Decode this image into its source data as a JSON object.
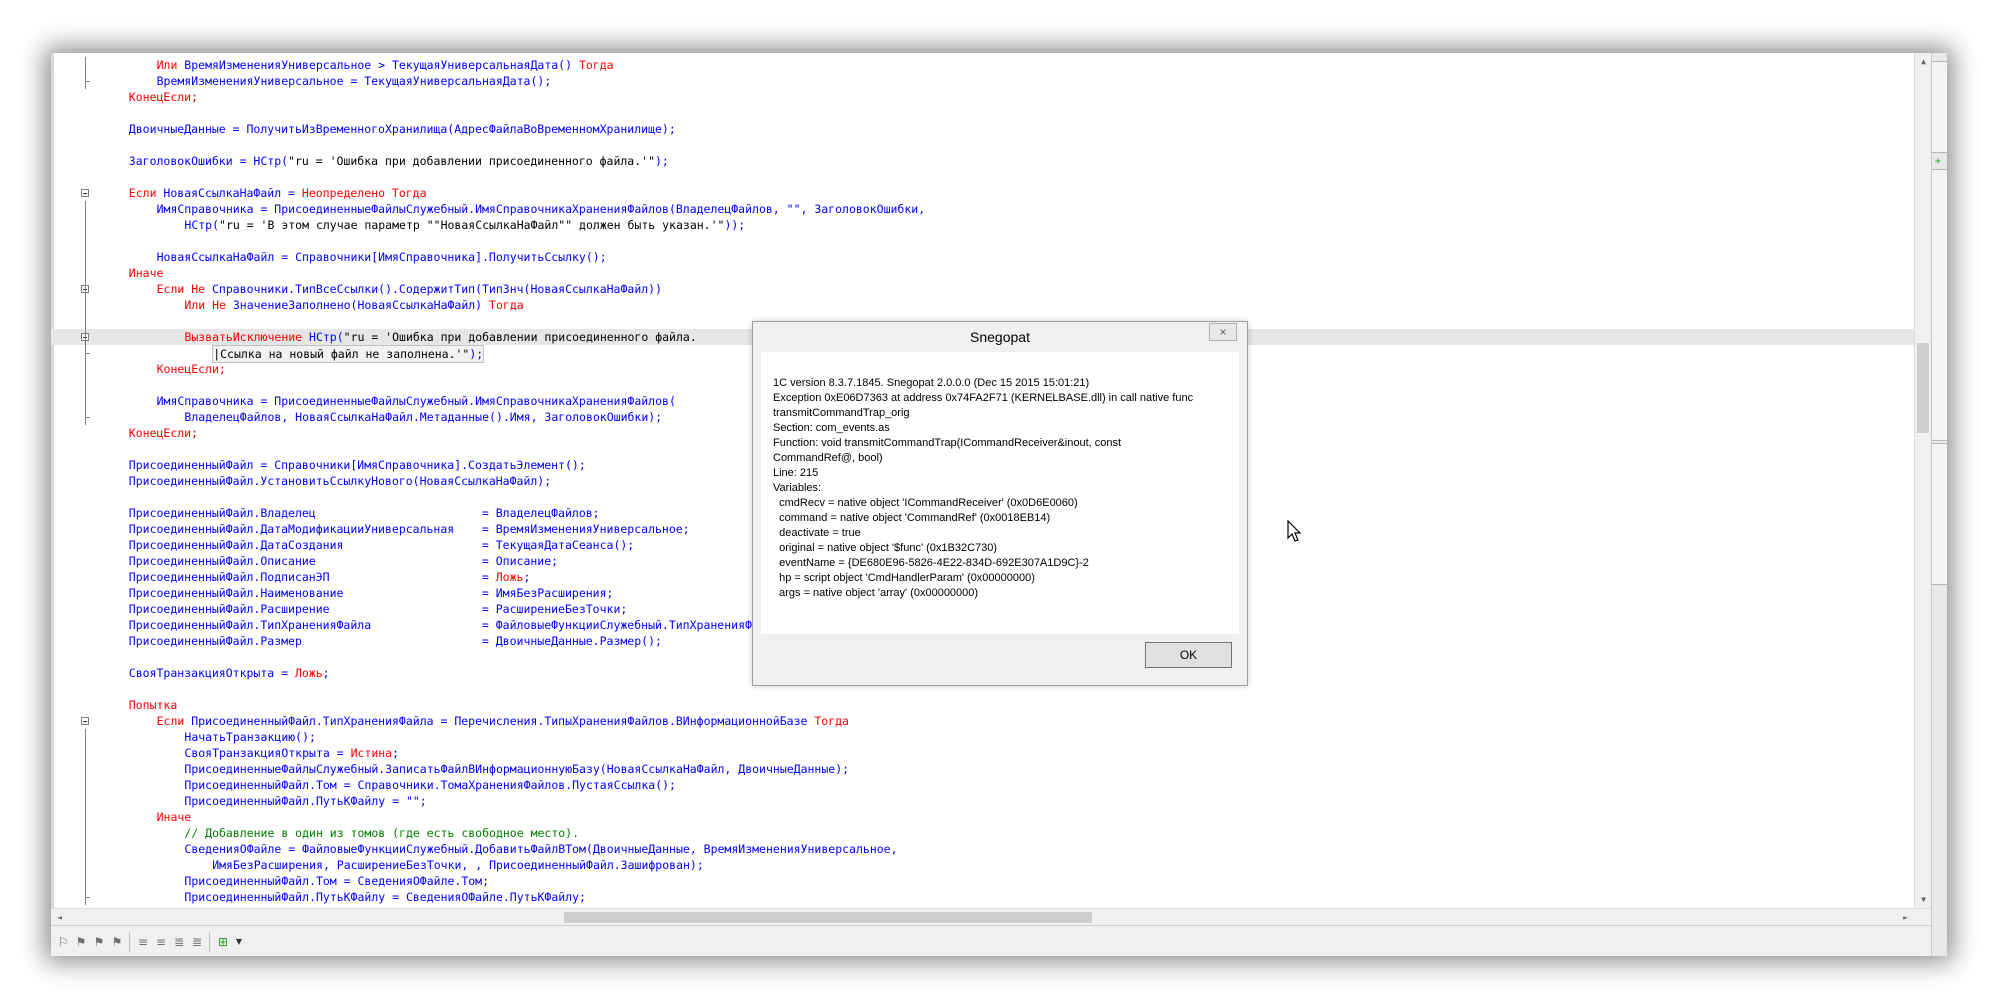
{
  "code_lines": [
    {
      "indent": "        ",
      "segments": [
        [
          "k",
          "Или "
        ],
        [
          "i",
          "ВремяИзмененияУниверсальное > ТекущаяУниверсальнаяДата() "
        ],
        [
          "k",
          "Тогда"
        ]
      ]
    },
    {
      "indent": "        ",
      "segments": [
        [
          "i",
          "ВремяИзмененияУниверсальное = ТекущаяУниверсальнаяДата();"
        ]
      ]
    },
    {
      "indent": "    ",
      "segments": [
        [
          "k",
          "КонецЕсли;"
        ]
      ]
    },
    {
      "indent": "",
      "segments": []
    },
    {
      "indent": "    ",
      "segments": [
        [
          "i",
          "ДвоичныеДанные = ПолучитьИзВременногоХранилища(АдресФайлаВоВременномХранилище);"
        ]
      ]
    },
    {
      "indent": "",
      "segments": []
    },
    {
      "indent": "    ",
      "segments": [
        [
          "i",
          "ЗаголовокОшибки = НСтр("
        ],
        [
          "s",
          "\"ru = 'Ошибка при добавлении присоединенного файла.'\""
        ],
        [
          "i",
          ");"
        ]
      ]
    },
    {
      "indent": "",
      "segments": []
    },
    {
      "indent": "    ",
      "segments": [
        [
          "k",
          "Если "
        ],
        [
          "i",
          "НоваяСсылкаНаФайл = "
        ],
        [
          "k",
          "Неопределено Тогда"
        ]
      ]
    },
    {
      "indent": "        ",
      "segments": [
        [
          "i",
          "ИмяСправочника = ПрисоединенныеФайлыСлужебный.ИмяСправочникаХраненияФайлов(ВладелецФайлов, \"\", ЗаголовокОшибки,"
        ]
      ]
    },
    {
      "indent": "            ",
      "segments": [
        [
          "i",
          "НСтр("
        ],
        [
          "s",
          "\"ru = 'В этом случае параметр \"\"НоваяСсылкаНаФайл\"\" должен быть указан.'\""
        ],
        [
          "i",
          "));"
        ]
      ]
    },
    {
      "indent": "",
      "segments": []
    },
    {
      "indent": "        ",
      "segments": [
        [
          "i",
          "НоваяСсылкаНаФайл = Справочники[ИмяСправочника].ПолучитьСсылку();"
        ]
      ]
    },
    {
      "indent": "    ",
      "segments": [
        [
          "k",
          "Иначе"
        ]
      ]
    },
    {
      "indent": "        ",
      "segments": [
        [
          "k",
          "Если Не "
        ],
        [
          "i",
          "Справочники.ТипВсеСсылки().СодержитТип(ТипЗнч(НоваяСсылкаНаФайл))"
        ]
      ]
    },
    {
      "indent": "            ",
      "segments": [
        [
          "k",
          "Или Не "
        ],
        [
          "i",
          "ЗначениеЗаполнено(НоваяСсылкаНаФайл) "
        ],
        [
          "k",
          "Тогда"
        ]
      ]
    },
    {
      "indent": "",
      "segments": []
    },
    {
      "indent": "            ",
      "segments": [
        [
          "k",
          "ВызватьИсключение "
        ],
        [
          "i",
          "НСтр("
        ],
        [
          "s",
          "\"ru = 'Ошибка при добавлении присоединенного файла."
        ]
      ]
    },
    {
      "indent": "                ",
      "segments": [
        [
          "s",
          "|Ссылка на новый файл не заполнена.'\""
        ],
        [
          "i",
          ");"
        ]
      ]
    },
    {
      "indent": "        ",
      "segments": [
        [
          "k",
          "КонецЕсли;"
        ]
      ]
    },
    {
      "indent": "",
      "segments": []
    },
    {
      "indent": "        ",
      "segments": [
        [
          "i",
          "ИмяСправочника = ПрисоединенныеФайлыСлужебный.ИмяСправочникаХраненияФайлов("
        ]
      ]
    },
    {
      "indent": "            ",
      "segments": [
        [
          "i",
          "ВладелецФайлов, НоваяСсылкаНаФайл.Метаданные().Имя, ЗаголовокОшибки);"
        ]
      ]
    },
    {
      "indent": "    ",
      "segments": [
        [
          "k",
          "КонецЕсли;"
        ]
      ]
    },
    {
      "indent": "",
      "segments": []
    },
    {
      "indent": "    ",
      "segments": [
        [
          "i",
          "ПрисоединенныйФайл = Справочники[ИмяСправочника].СоздатьЭлемент();"
        ]
      ]
    },
    {
      "indent": "    ",
      "segments": [
        [
          "i",
          "ПрисоединенныйФайл.УстановитьСсылкуНового(НоваяСсылкаНаФайл);"
        ]
      ]
    },
    {
      "indent": "",
      "segments": []
    },
    {
      "indent": "    ",
      "segments": [
        [
          "i",
          "ПрисоединенныйФайл.Владелец                        = ВладелецФайлов;"
        ]
      ]
    },
    {
      "indent": "    ",
      "segments": [
        [
          "i",
          "ПрисоединенныйФайл.ДатаМодификацииУниверсальная    = ВремяИзмененияУниверсальное;"
        ]
      ]
    },
    {
      "indent": "    ",
      "segments": [
        [
          "i",
          "ПрисоединенныйФайл.ДатаСоздания                    = ТекущаяДатаСеанса();"
        ]
      ]
    },
    {
      "indent": "    ",
      "segments": [
        [
          "i",
          "ПрисоединенныйФайл.Описание                        = Описание;"
        ]
      ]
    },
    {
      "indent": "    ",
      "segments": [
        [
          "i",
          "ПрисоединенныйФайл.ПодписанЭП                      = "
        ],
        [
          "k",
          "Ложь"
        ],
        [
          "i",
          ";"
        ]
      ]
    },
    {
      "indent": "    ",
      "segments": [
        [
          "i",
          "ПрисоединенныйФайл.Наименование                    = ИмяБезРасширения;"
        ]
      ]
    },
    {
      "indent": "    ",
      "segments": [
        [
          "i",
          "ПрисоединенныйФайл.Расширение                      = РасширениеБезТочки;"
        ]
      ]
    },
    {
      "indent": "    ",
      "segments": [
        [
          "i",
          "ПрисоединенныйФайл.ТипХраненияФайла                = ФайловыеФункцииСлужебный.ТипХраненияФайлов();"
        ]
      ]
    },
    {
      "indent": "    ",
      "segments": [
        [
          "i",
          "ПрисоединенныйФайл.Размер                          = ДвоичныеДанные.Размер();"
        ]
      ]
    },
    {
      "indent": "",
      "segments": []
    },
    {
      "indent": "    ",
      "segments": [
        [
          "i",
          "СвояТранзакцияОткрыта = "
        ],
        [
          "k",
          "Ложь"
        ],
        [
          "i",
          ";"
        ]
      ]
    },
    {
      "indent": "",
      "segments": []
    },
    {
      "indent": "    ",
      "segments": [
        [
          "k",
          "Попытка"
        ]
      ]
    },
    {
      "indent": "        ",
      "segments": [
        [
          "k",
          "Если "
        ],
        [
          "i",
          "ПрисоединенныйФайл.ТипХраненияФайла = Перечисления.ТипыХраненияФайлов.ВИнформационнойБазе "
        ],
        [
          "k",
          "Тогда"
        ]
      ]
    },
    {
      "indent": "            ",
      "segments": [
        [
          "i",
          "НачатьТранзакцию();"
        ]
      ]
    },
    {
      "indent": "            ",
      "segments": [
        [
          "i",
          "СвояТранзакцияОткрыта = "
        ],
        [
          "k",
          "Истина"
        ],
        [
          "i",
          ";"
        ]
      ]
    },
    {
      "indent": "            ",
      "segments": [
        [
          "i",
          "ПрисоединенныеФайлыСлужебный.ЗаписатьФайлВИнформационнуюБазу(НоваяСсылкаНаФайл, ДвоичныеДанные);"
        ]
      ]
    },
    {
      "indent": "            ",
      "segments": [
        [
          "i",
          "ПрисоединенныйФайл.Том = Справочники.ТомаХраненияФайлов.ПустаяСсылка();"
        ]
      ]
    },
    {
      "indent": "            ",
      "segments": [
        [
          "i",
          "ПрисоединенныйФайл.ПутьКФайлу = \"\";"
        ]
      ]
    },
    {
      "indent": "        ",
      "segments": [
        [
          "k",
          "Иначе"
        ]
      ]
    },
    {
      "indent": "            ",
      "segments": [
        [
          "c",
          "// Добавление в один из томов (где есть свободное место)."
        ]
      ]
    },
    {
      "indent": "            ",
      "segments": [
        [
          "i",
          "СведенияОФайле = ФайловыеФункцииСлужебный.ДобавитьФайлВТом(ДвоичныеДанные, ВремяИзмененияУниверсальное,"
        ]
      ]
    },
    {
      "indent": "                ",
      "segments": [
        [
          "i",
          "ИмяБезРасширения, РасширениеБезТочки, , ПрисоединенныйФайл.Зашифрован);"
        ]
      ]
    },
    {
      "indent": "            ",
      "segments": [
        [
          "i",
          "ПрисоединенныйФайл.Том = СведенияОФайле.Том;"
        ]
      ]
    },
    {
      "indent": "            ",
      "segments": [
        [
          "i",
          "ПрисоединенныйФайл.ПутьКФайлу = СведенияОФайле.ПутьКФайлу;"
        ]
      ]
    }
  ],
  "colors": {
    "keyword": "#ff0000",
    "identifier": "#0000ff",
    "string": "#000000",
    "comment": "#008000",
    "fold_box": "#808080",
    "dialog_bg": "#f0f0f0"
  },
  "dialog": {
    "title": "Snegopat",
    "close_label": "×",
    "ok_label": "OK",
    "message_lines": [
      "1C version 8.3.7.1845. Snegopat 2.0.0.0 (Dec 15 2015 15:01:21)",
      "Exception 0xE06D7363 at address 0x74FA2F71 (KERNELBASE.dll) in call native func",
      "transmitCommandTrap_orig",
      "Section: com_events.as",
      "Function: void transmitCommandTrap(ICommandReceiver&inout, const",
      "CommandRef@, bool)",
      "Line: 215",
      "Variables:",
      "  cmdRecv = native object 'ICommandReceiver' (0x0D6E0060)",
      "  command = native object 'CommandRef' (0x0018EB14)",
      "  deactivate = true",
      "  original = native object '$func' (0x1B32C730)",
      "  eventName = {DE680E96-5826-4E22-834D-692E307A1D9C}-2",
      "  hp = script object 'CmdHandlerParam' (0x00000000)",
      "  args = native object 'array' (0x00000000)"
    ]
  },
  "icons": {
    "vscroll_up": "▲",
    "vscroll_down": "▼",
    "hscroll_left": "◄",
    "hscroll_right": "►",
    "toolbar": [
      "bookmark-toggle-icon",
      "bookmark-prev-icon",
      "bookmark-next-icon",
      "bookmark-clear-icon",
      "indent-icon",
      "outdent-icon",
      "comment-icon",
      "uncomment-icon",
      "add-item-icon"
    ]
  }
}
